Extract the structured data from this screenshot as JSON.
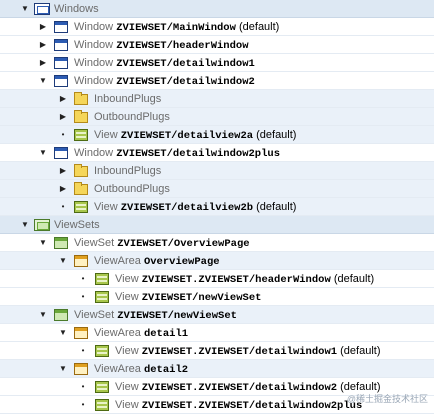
{
  "tree": {
    "windows": {
      "label": "Windows"
    },
    "w1": {
      "kind": "Window",
      "name": "ZVIEWSET/MainWindow",
      "suffix": "(default)"
    },
    "w2": {
      "kind": "Window",
      "name": "ZVIEWSET/headerWindow",
      "suffix": ""
    },
    "w3": {
      "kind": "Window",
      "name": "ZVIEWSET/detailwindow1",
      "suffix": ""
    },
    "w4": {
      "kind": "Window",
      "name": "ZVIEWSET/detailwindow2",
      "suffix": ""
    },
    "w4_in": {
      "label": "InboundPlugs"
    },
    "w4_out": {
      "label": "OutboundPlugs"
    },
    "w4_view": {
      "kind": "View",
      "name": "ZVIEWSET/detailview2a",
      "suffix": "(default)"
    },
    "w5": {
      "kind": "Window",
      "name": "ZVIEWSET/detailwindow2plus",
      "suffix": ""
    },
    "w5_in": {
      "label": "InboundPlugs"
    },
    "w5_out": {
      "label": "OutboundPlugs"
    },
    "w5_view": {
      "kind": "View",
      "name": "ZVIEWSET/detailview2b",
      "suffix": "(default)"
    },
    "viewsets": {
      "label": "ViewSets"
    },
    "vs1": {
      "kind": "ViewSet",
      "name": "ZVIEWSET/OverviewPage"
    },
    "vs1_area": {
      "kind": "ViewArea",
      "name": "OverviewPage"
    },
    "vs1_v1": {
      "kind": "View",
      "name": "ZVIEWSET.ZVIEWSET/headerWindow",
      "suffix": "(default)"
    },
    "vs1_v2": {
      "kind": "View",
      "name": "ZVIEWSET/newViewSet",
      "suffix": ""
    },
    "vs2": {
      "kind": "ViewSet",
      "name": "ZVIEWSET/newViewSet"
    },
    "vs2_a1": {
      "kind": "ViewArea",
      "name": "detail1"
    },
    "vs2_a1_v": {
      "kind": "View",
      "name": "ZVIEWSET.ZVIEWSET/detailwindow1",
      "suffix": "(default)"
    },
    "vs2_a2": {
      "kind": "ViewArea",
      "name": "detail2"
    },
    "vs2_a2_v1": {
      "kind": "View",
      "name": "ZVIEWSET.ZVIEWSET/detailwindow2",
      "suffix": "(default)"
    },
    "vs2_a2_v2": {
      "kind": "View",
      "name": "ZVIEWSET.ZVIEWSET/detailwindow2plus",
      "suffix": ""
    }
  },
  "watermark": "@稀土掘金技术社区"
}
